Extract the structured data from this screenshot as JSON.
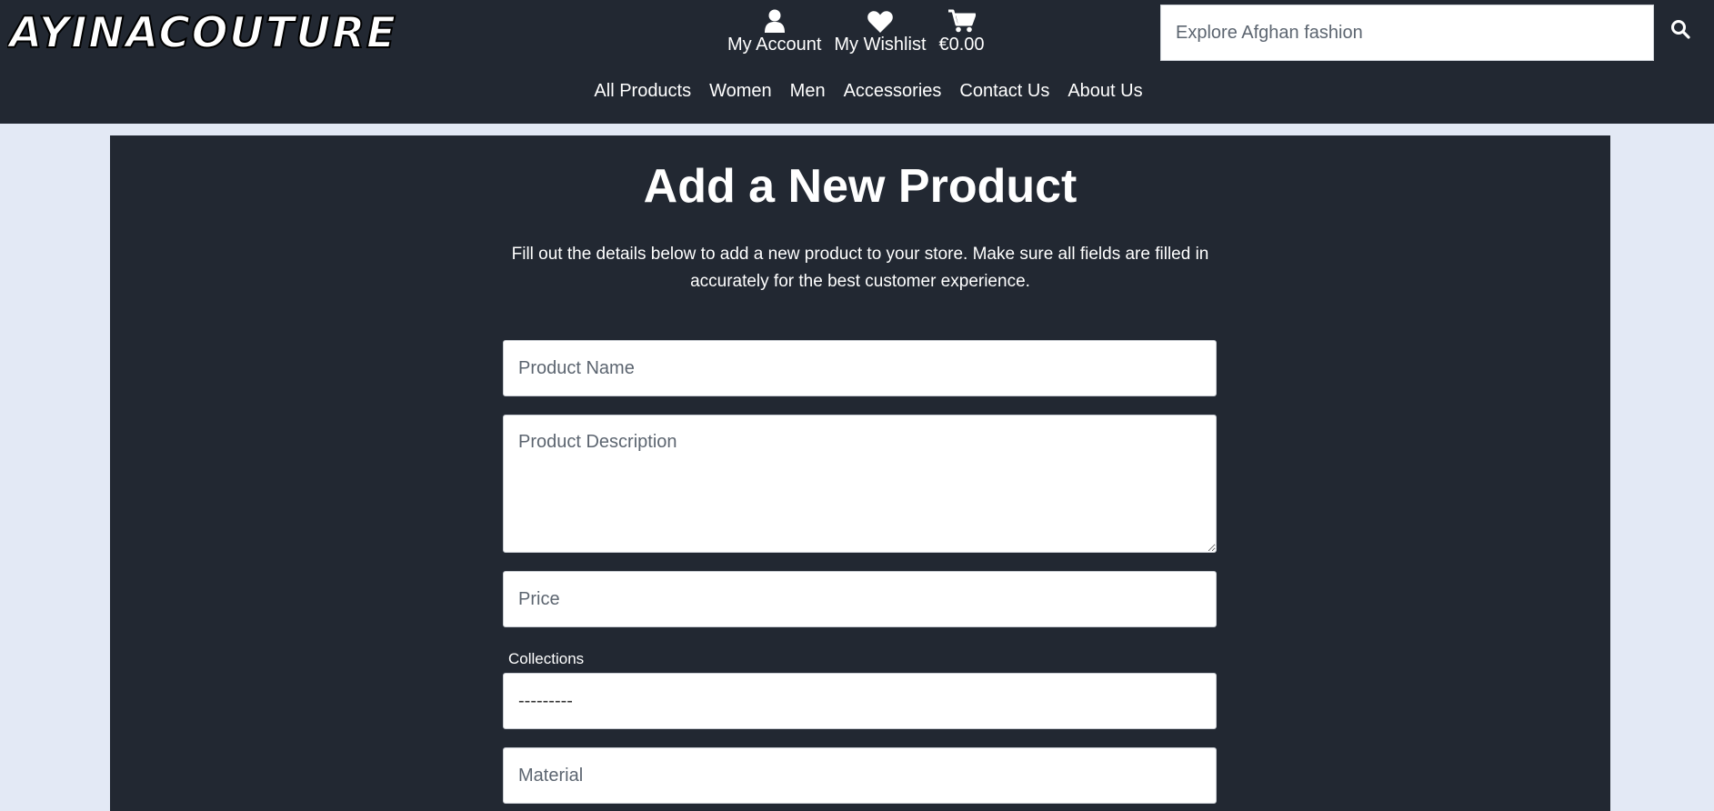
{
  "header": {
    "logo_text": "AYINACOUTURE",
    "account_links": [
      {
        "icon": "user-icon",
        "label": "My Account"
      },
      {
        "icon": "heart-icon",
        "label": "My Wishlist"
      },
      {
        "icon": "cart-icon",
        "label": "€0.00"
      }
    ],
    "search": {
      "placeholder": "Explore Afghan fashion",
      "icon": "search-icon"
    },
    "nav": [
      "All Products",
      "Women",
      "Men",
      "Accessories",
      "Contact Us",
      "About Us"
    ]
  },
  "main": {
    "title": "Add a New Product",
    "intro": "Fill out the details below to add a new product to your store. Make sure all fields are filled in accurately for the best customer experience.",
    "form": {
      "product_name_placeholder": "Product Name",
      "product_description_placeholder": "Product Description",
      "price_placeholder": "Price",
      "collections_label": "Collections",
      "collections_selected": "---------",
      "material_placeholder": "Material"
    }
  },
  "colors": {
    "header_bg": "#222832",
    "page_bg": "#e3e9f5",
    "panel_bg": "#222832",
    "text_light": "#ffffff"
  }
}
